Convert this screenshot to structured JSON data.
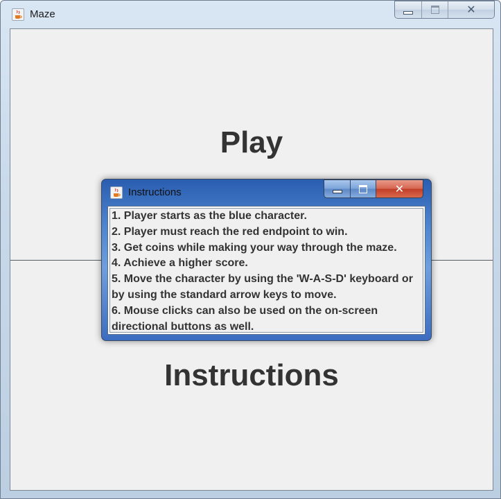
{
  "main_window": {
    "title": "Maze",
    "icon": "java-cup-icon",
    "controls": [
      "minimize",
      "maximize",
      "close"
    ],
    "buttons": {
      "play": "Play",
      "instructions": "Instructions"
    }
  },
  "dialog": {
    "title": "Instructions",
    "icon": "java-cup-icon",
    "controls": [
      "minimize",
      "maximize",
      "close"
    ],
    "lines": [
      "1. Player starts as the blue character.",
      "2. Player must reach the red endpoint to win.",
      "3. Get coins while making your way through the maze.",
      "4. Achieve a higher score.",
      "5. Move the character by using the 'W-A-S-D' keyboard or",
      "by using the standard arrow keys to move.",
      "6. Mouse clicks can also be used on the on-screen",
      "directional buttons as well."
    ]
  },
  "colors": {
    "close_button_active": "#c13d28",
    "dialog_frame": "#4f86d0",
    "client_background": "#f0f0f0"
  }
}
